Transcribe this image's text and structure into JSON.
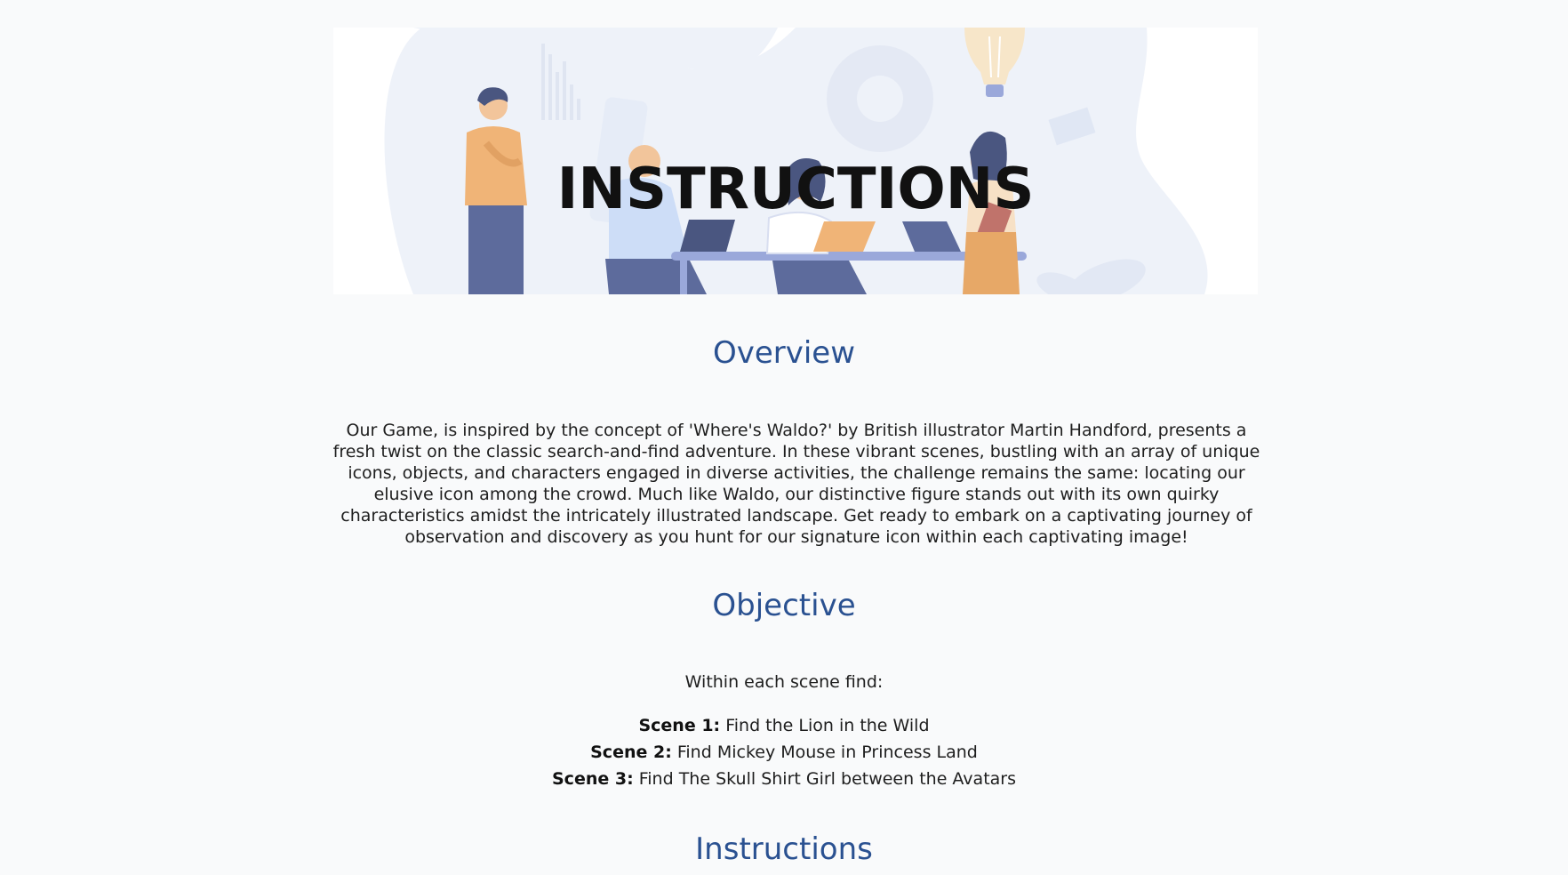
{
  "hero": {
    "title": "INSTRUCTIONS"
  },
  "overview": {
    "heading": "Overview",
    "text": "Our Game, is inspired by the concept of 'Where's Waldo?' by British illustrator Martin Handford, presents a fresh twist on the classic search-and-find adventure. In these vibrant scenes, bustling with an array of unique icons, objects, and characters engaged in diverse activities, the challenge remains the same: locating our elusive icon among the crowd. Much like Waldo, our distinctive figure stands out with its own quirky characteristics amidst the intricately illustrated landscape. Get ready to embark on a captivating journey of observation and discovery as you hunt for our signature icon within each captivating image!"
  },
  "objective": {
    "heading": "Objective",
    "intro": "Within each scene find:",
    "scenes": [
      {
        "label": "Scene 1:",
        "text": " Find the Lion in the Wild"
      },
      {
        "label": "Scene 2:",
        "text": " Find Mickey Mouse in Princess Land"
      },
      {
        "label": "Scene 3:",
        "text": " Find The Skull Shirt Girl between the Avatars"
      }
    ]
  },
  "instructions": {
    "heading": "Instructions"
  },
  "colors": {
    "heading": "#2a5191",
    "text": "#1e1e1e",
    "background": "#f9fafb",
    "illustration_blob": "#eef2f9",
    "accent_orange": "#f0b477",
    "accent_navy": "#5d6b9c"
  },
  "icons": [
    "team-illustration"
  ]
}
